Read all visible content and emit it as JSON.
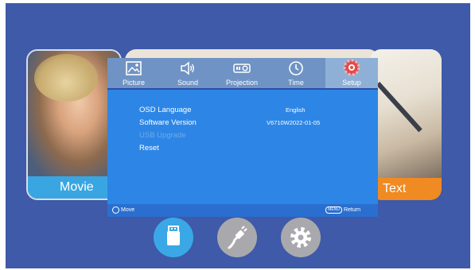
{
  "cards": {
    "left_label": "Movie",
    "right_label": "Text"
  },
  "tabs": [
    {
      "label": "Picture",
      "icon": "picture-icon",
      "active": false
    },
    {
      "label": "Sound",
      "icon": "speaker-icon",
      "active": false
    },
    {
      "label": "Projection",
      "icon": "projector-icon",
      "active": false
    },
    {
      "label": "Time",
      "icon": "clock-icon",
      "active": false
    },
    {
      "label": "Setup",
      "icon": "setup-gear-icon",
      "active": true
    }
  ],
  "setup_menu": {
    "items": [
      {
        "label": "OSD Language",
        "value": "English",
        "enabled": true
      },
      {
        "label": "Software Version",
        "value": "V6710W2022-01-05",
        "enabled": true
      },
      {
        "label": "USB Upgrade",
        "value": "",
        "enabled": false
      },
      {
        "label": "Reset",
        "value": "",
        "enabled": true
      }
    ]
  },
  "footer": {
    "move_label": "Move",
    "menu_key": "MENU",
    "return_label": "Return"
  },
  "bottom_icons": [
    {
      "icon": "usb-icon",
      "selected": true
    },
    {
      "icon": "cable-icon",
      "selected": false
    },
    {
      "icon": "gear-icon",
      "selected": false
    }
  ],
  "colors": {
    "background": "#3e5aa8",
    "panel": "#2d86e6",
    "tabbar": "#6f93c4",
    "active_tab": "#8fb0d6",
    "movie_label": "#39a6e2",
    "text_label": "#f08a22"
  }
}
